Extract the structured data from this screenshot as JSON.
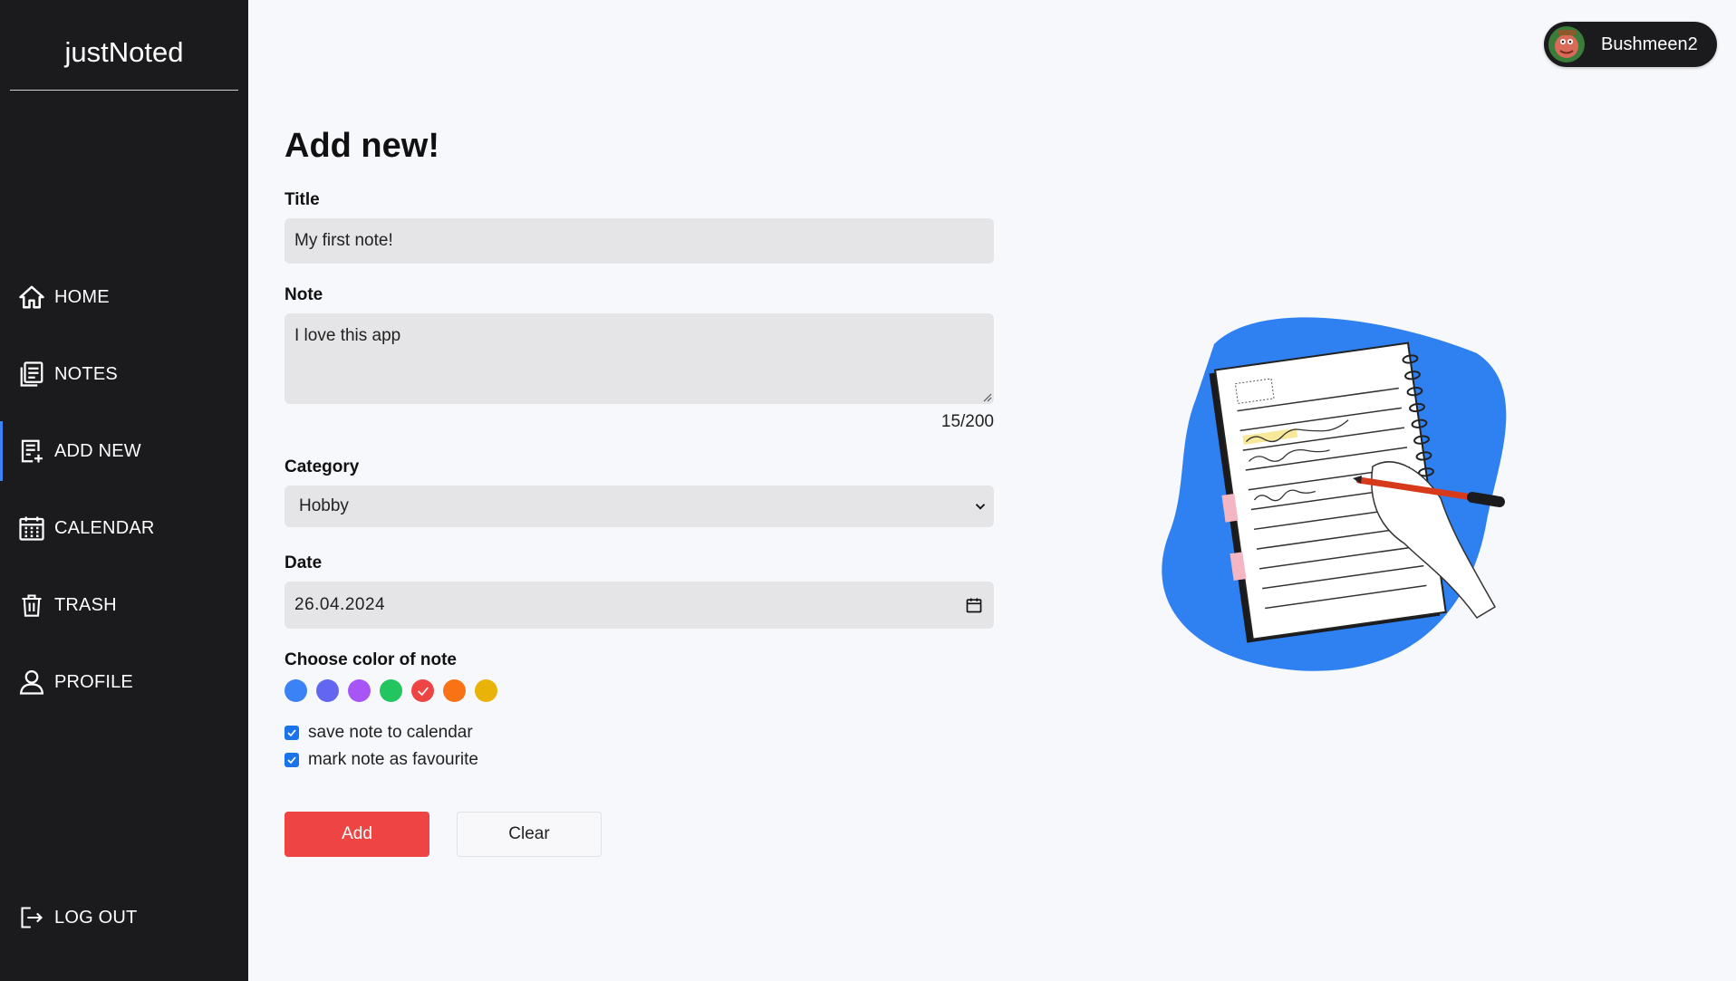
{
  "app": {
    "brand": "justNoted"
  },
  "sidebar": {
    "items": [
      {
        "label": "HOME",
        "icon": "home-icon"
      },
      {
        "label": "NOTES",
        "icon": "notes-icon"
      },
      {
        "label": "ADD NEW",
        "icon": "add-note-icon",
        "active": true
      },
      {
        "label": "CALENDAR",
        "icon": "calendar-icon"
      },
      {
        "label": "TRASH",
        "icon": "trash-icon"
      },
      {
        "label": "PROFILE",
        "icon": "user-icon"
      }
    ],
    "logout": {
      "label": "LOG OUT",
      "icon": "logout-icon"
    }
  },
  "user": {
    "name": "Bushmeen2"
  },
  "form": {
    "heading": "Add new!",
    "title_label": "Title",
    "title_value": "My first note!",
    "note_label": "Note",
    "note_value": "I love this app",
    "note_counter": "15/200",
    "category_label": "Category",
    "category_value": "Hobby",
    "date_label": "Date",
    "date_value": "26.04.2024",
    "color_label": "Choose color of note",
    "colors": [
      "#3b82f6",
      "#6366f1",
      "#a855f7",
      "#22c55e",
      "#ef4444",
      "#f97316",
      "#eab308"
    ],
    "selected_color": "#ef4444",
    "checkbox_calendar": "save note to calendar",
    "checkbox_favourite": "mark note as favourite",
    "calendar_checked": true,
    "favourite_checked": true,
    "add_label": "Add",
    "clear_label": "Clear"
  },
  "theme": {
    "accent": "#3b82f6",
    "sidebar_bg": "#1b1b1d",
    "danger": "#ef4444"
  }
}
